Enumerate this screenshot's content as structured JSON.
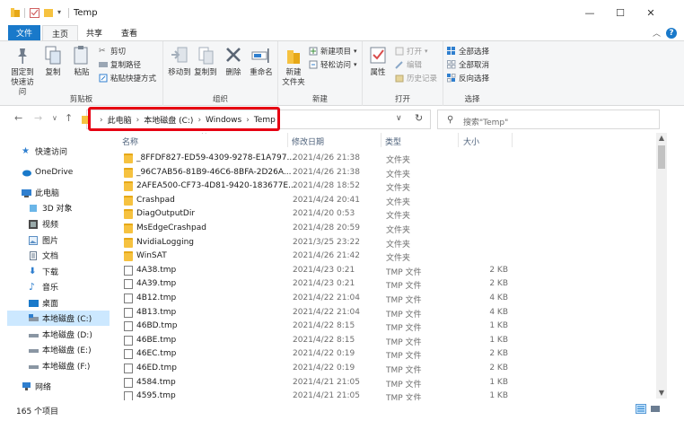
{
  "window": {
    "title": "Temp",
    "minimize_glyph": "—",
    "maximize_glyph": "☐",
    "close_glyph": "✕"
  },
  "ribbon_tabs": [
    "文件",
    "主页",
    "共享",
    "查看"
  ],
  "help_glyph": "?",
  "ribbon": {
    "clipboard": {
      "label": "剪贴板",
      "pin": "固定到\n快速访问",
      "copy": "复制",
      "paste": "粘贴",
      "cut": "剪切",
      "copy_path": "复制路径",
      "paste_shortcut": "粘贴快捷方式"
    },
    "organize": {
      "label": "组织",
      "move_to": "移动到",
      "copy_to": "复制到",
      "delete": "删除",
      "rename": "重命名"
    },
    "new": {
      "label": "新建",
      "new_folder": "新建\n文件夹",
      "new_item": "新建项目",
      "easy_access": "轻松访问"
    },
    "open": {
      "label": "打开",
      "properties": "属性",
      "open": "打开",
      "edit": "编辑",
      "history": "历史记录"
    },
    "select": {
      "label": "选择",
      "select_all": "全部选择",
      "select_none": "全部取消",
      "invert": "反向选择"
    }
  },
  "address": {
    "crumbs": [
      "此电脑",
      "本地磁盘 (C:)",
      "Windows",
      "Temp"
    ],
    "search_placeholder": "搜索\"Temp\""
  },
  "sidebar": {
    "items": [
      {
        "label": "快速访问",
        "icon": "star-icon"
      },
      {
        "label": "OneDrive",
        "icon": "cloud-icon"
      },
      {
        "label": "此电脑",
        "icon": "computer-icon"
      },
      {
        "label": "3D 对象",
        "icon": "cube-icon"
      },
      {
        "label": "视频",
        "icon": "video-icon"
      },
      {
        "label": "图片",
        "icon": "picture-icon"
      },
      {
        "label": "文档",
        "icon": "document-icon"
      },
      {
        "label": "下载",
        "icon": "download-icon"
      },
      {
        "label": "音乐",
        "icon": "music-icon"
      },
      {
        "label": "桌面",
        "icon": "desktop-icon"
      },
      {
        "label": "本地磁盘 (C:)",
        "icon": "drive-icon"
      },
      {
        "label": "本地磁盘 (D:)",
        "icon": "drive-icon"
      },
      {
        "label": "本地磁盘 (E:)",
        "icon": "drive-icon"
      },
      {
        "label": "本地磁盘 (F:)",
        "icon": "drive-icon"
      },
      {
        "label": "网络",
        "icon": "network-icon"
      }
    ]
  },
  "columns": {
    "name": "名称",
    "date": "修改日期",
    "type": "类型",
    "size": "大小"
  },
  "files": [
    {
      "name": "_8FFDF827-ED59-4309-9278-E1A797...",
      "date": "2021/4/26 21:38",
      "type": "文件夹",
      "size": "",
      "kind": "folder"
    },
    {
      "name": "_96C7AB56-81B9-46C6-8BFA-2D26A...",
      "date": "2021/4/26 21:38",
      "type": "文件夹",
      "size": "",
      "kind": "folder"
    },
    {
      "name": "2AFEA500-CF73-4D81-9420-183677E...",
      "date": "2021/4/28 18:52",
      "type": "文件夹",
      "size": "",
      "kind": "folder"
    },
    {
      "name": "Crashpad",
      "date": "2021/4/24 20:41",
      "type": "文件夹",
      "size": "",
      "kind": "folder"
    },
    {
      "name": "DiagOutputDir",
      "date": "2021/4/20 0:53",
      "type": "文件夹",
      "size": "",
      "kind": "folder"
    },
    {
      "name": "MsEdgeCrashpad",
      "date": "2021/4/28 20:59",
      "type": "文件夹",
      "size": "",
      "kind": "folder"
    },
    {
      "name": "NvidiaLogging",
      "date": "2021/3/25 23:22",
      "type": "文件夹",
      "size": "",
      "kind": "folder"
    },
    {
      "name": "WinSAT",
      "date": "2021/4/26 21:42",
      "type": "文件夹",
      "size": "",
      "kind": "folder"
    },
    {
      "name": "4A38.tmp",
      "date": "2021/4/23 0:21",
      "type": "TMP 文件",
      "size": "2 KB",
      "kind": "file"
    },
    {
      "name": "4A39.tmp",
      "date": "2021/4/23 0:21",
      "type": "TMP 文件",
      "size": "2 KB",
      "kind": "file"
    },
    {
      "name": "4B12.tmp",
      "date": "2021/4/22 21:04",
      "type": "TMP 文件",
      "size": "4 KB",
      "kind": "file"
    },
    {
      "name": "4B13.tmp",
      "date": "2021/4/22 21:04",
      "type": "TMP 文件",
      "size": "4 KB",
      "kind": "file"
    },
    {
      "name": "46BD.tmp",
      "date": "2021/4/22 8:15",
      "type": "TMP 文件",
      "size": "1 KB",
      "kind": "file"
    },
    {
      "name": "46BE.tmp",
      "date": "2021/4/22 8:15",
      "type": "TMP 文件",
      "size": "1 KB",
      "kind": "file"
    },
    {
      "name": "46EC.tmp",
      "date": "2021/4/22 0:19",
      "type": "TMP 文件",
      "size": "2 KB",
      "kind": "file"
    },
    {
      "name": "46ED.tmp",
      "date": "2021/4/22 0:19",
      "type": "TMP 文件",
      "size": "2 KB",
      "kind": "file"
    },
    {
      "name": "4584.tmp",
      "date": "2021/4/21 21:05",
      "type": "TMP 文件",
      "size": "1 KB",
      "kind": "file"
    },
    {
      "name": "4595.tmp",
      "date": "2021/4/21 21:05",
      "type": "TMP 文件",
      "size": "1 KB",
      "kind": "file"
    }
  ],
  "status": {
    "item_count": "165 个项目"
  },
  "colors": {
    "accent": "#1979ca",
    "highlight_box": "#e60012",
    "selection": "#cce8ff",
    "folder": "#f6c240"
  }
}
